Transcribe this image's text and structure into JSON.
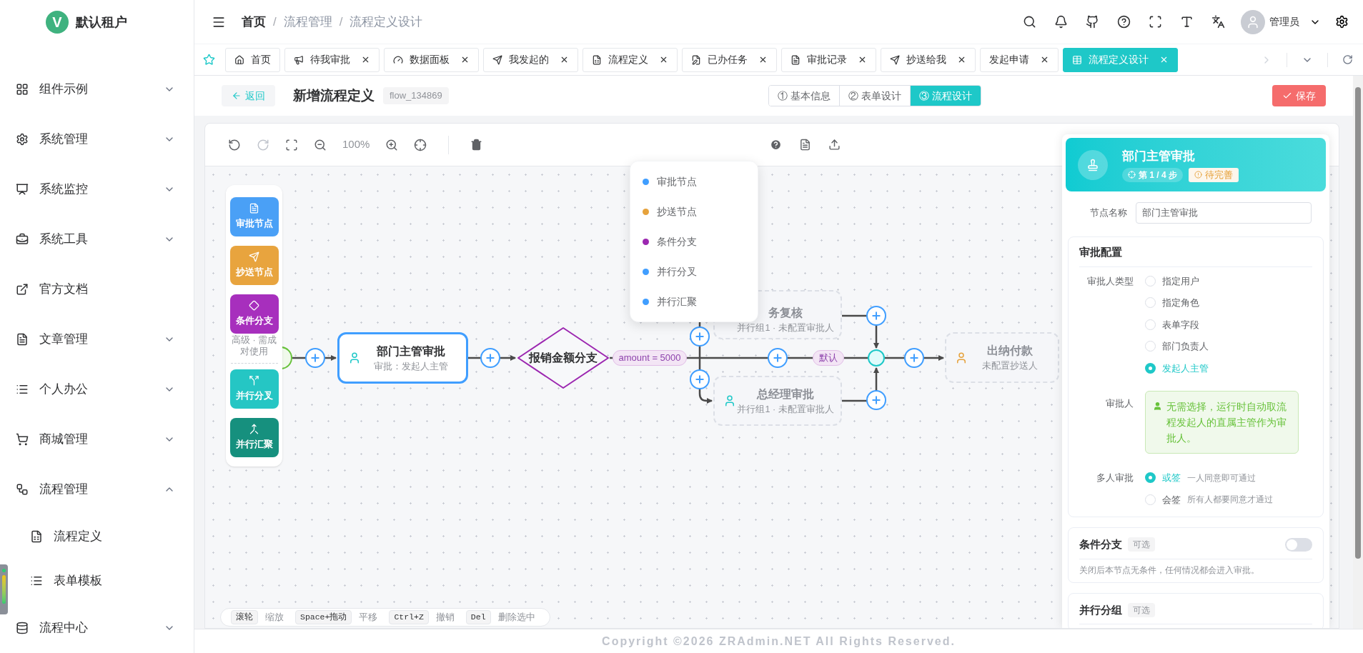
{
  "sidebar": {
    "logo_letter": "V",
    "logo_text": "默认租户",
    "items": [
      {
        "label": "组件示例",
        "kind": "menu",
        "expanded": false
      },
      {
        "label": "系统管理",
        "kind": "menu",
        "expanded": false
      },
      {
        "label": "系统监控",
        "kind": "menu",
        "expanded": false
      },
      {
        "label": "系统工具",
        "kind": "menu",
        "expanded": false
      },
      {
        "label": "官方文档",
        "kind": "link"
      },
      {
        "label": "文章管理",
        "kind": "menu",
        "expanded": false
      },
      {
        "label": "个人办公",
        "kind": "menu",
        "expanded": false
      },
      {
        "label": "商城管理",
        "kind": "menu",
        "expanded": false
      },
      {
        "label": "流程管理",
        "kind": "menu",
        "expanded": true,
        "children": [
          {
            "label": "流程定义"
          },
          {
            "label": "表单模板"
          }
        ]
      },
      {
        "label": "流程中心",
        "kind": "menu",
        "expanded": false
      }
    ]
  },
  "header": {
    "separator": "/",
    "breadcrumb": [
      {
        "label": "首页",
        "link": true
      },
      {
        "label": "流程管理",
        "link": false
      },
      {
        "label": "流程定义设计",
        "link": false
      }
    ],
    "user": "管理员"
  },
  "tabs": [
    {
      "label": "首页",
      "selected": false,
      "closable": false
    },
    {
      "label": "待我审批",
      "selected": false,
      "closable": true
    },
    {
      "label": "数据面板",
      "selected": false,
      "closable": true
    },
    {
      "label": "我发起的",
      "selected": false,
      "closable": true
    },
    {
      "label": "流程定义",
      "selected": false,
      "closable": true
    },
    {
      "label": "已办任务",
      "selected": false,
      "closable": true
    },
    {
      "label": "审批记录",
      "selected": false,
      "closable": true
    },
    {
      "label": "抄送给我",
      "selected": false,
      "closable": true
    },
    {
      "label": "发起申请",
      "selected": false,
      "closable": true
    },
    {
      "label": "流程定义设计",
      "selected": true,
      "closable": true
    }
  ],
  "page": {
    "back": "返回",
    "title": "新增流程定义",
    "code": "flow_134869",
    "steps": [
      {
        "label": "① 基本信息",
        "selected": false
      },
      {
        "label": "② 表单设计",
        "selected": false
      },
      {
        "label": "③ 流程设计",
        "selected": true
      }
    ],
    "save": "保存"
  },
  "toolbar": {
    "zoom": "100%"
  },
  "palette": [
    {
      "label": "审批节点",
      "color": "#4aa0f6"
    },
    {
      "label": "抄送节点",
      "color": "#e8a43e"
    },
    {
      "label": "条件分支",
      "color": "#a72fbd",
      "note": "高级 · 需成对使用"
    },
    {
      "label": "并行分叉",
      "color": "#25c6c4"
    },
    {
      "label": "并行汇聚",
      "color": "#16907e"
    }
  ],
  "menu": [
    {
      "label": "审批节点",
      "color": "#409eff"
    },
    {
      "label": "抄送节点",
      "color": "#e6a23c"
    },
    {
      "label": "条件分支",
      "color": "#9c27b0"
    },
    {
      "label": "并行分叉",
      "color": "#409eff"
    },
    {
      "label": "并行汇聚",
      "color": "#409eff"
    }
  ],
  "flow": {
    "nodes": [
      {
        "kind": "start"
      },
      {
        "kind": "approval",
        "title": "部门主管审批",
        "subtitle": "审批：发起人主管",
        "selected": true,
        "icon": true
      },
      {
        "kind": "condition",
        "title": "报销金额分支"
      },
      {
        "kind": "approval",
        "title": "务复核",
        "subtitle": "并行组1 · 未配置审批人",
        "selected": false,
        "icon": false
      },
      {
        "kind": "approval",
        "title": "总经理审批",
        "subtitle": "并行组1 · 未配置审批人",
        "selected": false,
        "icon": true
      },
      {
        "kind": "merge"
      },
      {
        "kind": "cc",
        "title": "出纳付款",
        "subtitle": "未配置抄送人",
        "selected": false,
        "icon": true
      }
    ],
    "edge_labels": [
      {
        "text": "amount = 5000"
      },
      {
        "text": "默认"
      }
    ]
  },
  "hints": [
    {
      "key": "滚轮",
      "action": "缩放"
    },
    {
      "key": "Space+拖动",
      "action": "平移"
    },
    {
      "key": "Ctrl+Z",
      "action": "撤销"
    },
    {
      "key": "Del",
      "action": "删除选中"
    }
  ],
  "panel": {
    "title": "部门主管审批",
    "step": "第 1 / 4 步",
    "status": "待完善",
    "name_label": "节点名称",
    "name_value": "部门主管审批",
    "config": {
      "title": "审批配置",
      "type_label": "审批人类型",
      "types": [
        {
          "label": "指定用户",
          "selected": false
        },
        {
          "label": "指定角色",
          "selected": false
        },
        {
          "label": "表单字段",
          "selected": false
        },
        {
          "label": "部门负责人",
          "selected": false
        },
        {
          "label": "发起人主管",
          "selected": true
        }
      ],
      "approver_label": "审批人",
      "approver_note": "无需选择，运行时自动取流程发起人的直属主管作为审批人。",
      "multi_label": "多人审批",
      "multi": [
        {
          "label": "或签",
          "hint": "一人同意即可通过",
          "selected": true
        },
        {
          "label": "会签",
          "hint": "所有人都要同意才通过",
          "selected": false
        }
      ]
    },
    "condition": {
      "title": "条件分支",
      "tag": "可选",
      "on": false,
      "note": "关闭后本节点无条件，任何情况都会进入审批。"
    },
    "parallel": {
      "title": "并行分组",
      "tag": "可选"
    }
  },
  "footer": "Copyright ©2026 ZRAdmin.NET All Rights Reserved."
}
